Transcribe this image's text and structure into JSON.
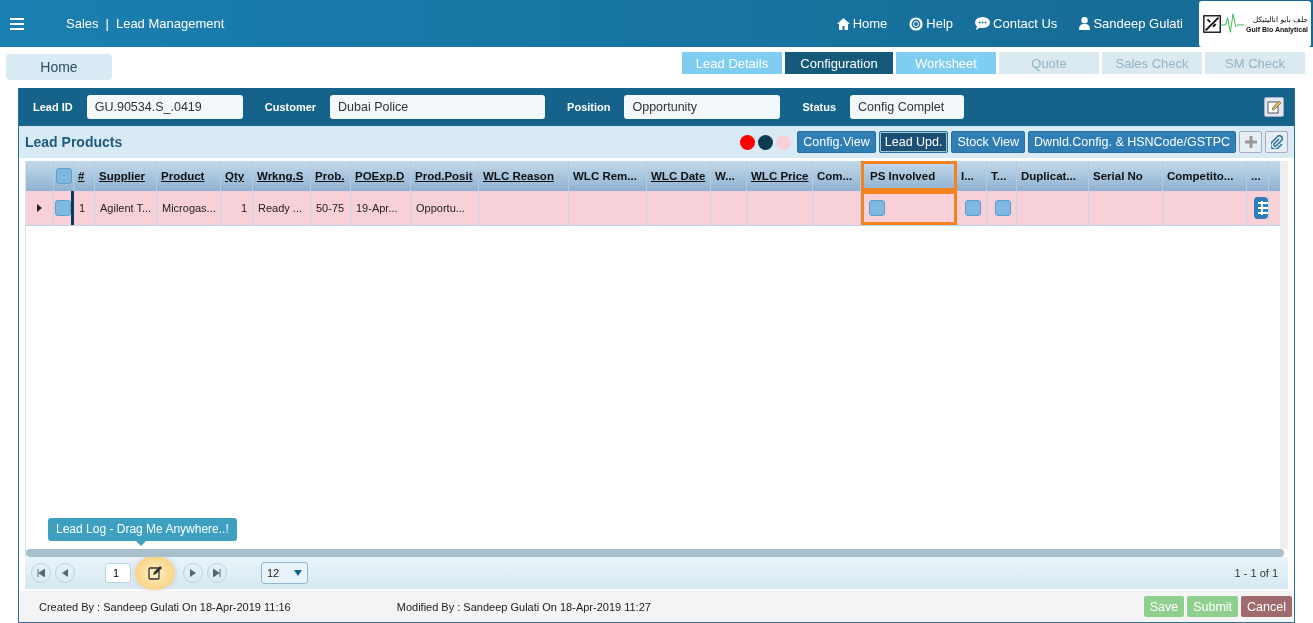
{
  "header": {
    "module": "Sales",
    "separator": "|",
    "title": "Lead Management",
    "nav": [
      {
        "kind": "home",
        "label": "Home"
      },
      {
        "kind": "help",
        "label": "Help"
      },
      {
        "kind": "contact",
        "label": "Contact Us"
      },
      {
        "kind": "user",
        "label": "Sandeep Gulati"
      }
    ],
    "logo": {
      "arabic": "جلف بايو اناليتيكل",
      "english": "Gulf Bio Analytical"
    }
  },
  "home_button": "Home",
  "tabs": [
    {
      "label": "Lead Details",
      "selected": false,
      "disabled": false
    },
    {
      "label": "Configuration",
      "selected": true,
      "disabled": false
    },
    {
      "label": "Worksheet",
      "selected": false,
      "disabled": false
    },
    {
      "label": "Quote",
      "selected": false,
      "disabled": true
    },
    {
      "label": "Sales Check",
      "selected": false,
      "disabled": true
    },
    {
      "label": "SM Check",
      "selected": false,
      "disabled": true
    }
  ],
  "form": [
    {
      "label": "Lead ID",
      "value": "GU.90534.S_.0419"
    },
    {
      "label": "Customer",
      "value": "Dubai Police"
    },
    {
      "label": "Position",
      "value": "Opportunity"
    },
    {
      "label": "Status",
      "value": "Config Complet"
    }
  ],
  "panel_title": "Lead Products",
  "legend": [
    {
      "color": "#ff0000"
    },
    {
      "color": "#0d3b52"
    },
    {
      "color": "#f7d0d8"
    }
  ],
  "toolbar": [
    {
      "label": "Config.View",
      "selected": false
    },
    {
      "label": "Lead Upd.",
      "selected": true
    },
    {
      "label": "Stock View",
      "selected": false
    },
    {
      "label": "Dwnld.Config. & HSNCode/GSTPC",
      "selected": false
    }
  ],
  "columns": [
    {
      "kind": "expand"
    },
    {
      "kind": "check",
      "checked": false
    },
    {
      "label": "#",
      "sortable": true,
      "highlighted": false
    },
    {
      "label": "Supplier",
      "sortable": true,
      "highlighted": false
    },
    {
      "label": "Product",
      "sortable": true,
      "highlighted": false
    },
    {
      "label": "Qty",
      "sortable": true,
      "highlighted": false
    },
    {
      "label": "Wrkng.S",
      "sortable": true,
      "highlighted": false
    },
    {
      "label": "Prob.",
      "sortable": true,
      "highlighted": false
    },
    {
      "label": "POExp.D",
      "sortable": true,
      "highlighted": false
    },
    {
      "label": "Prod.Posit",
      "sortable": true,
      "highlighted": false
    },
    {
      "label": "WLC Reason",
      "sortable": true,
      "highlighted": false
    },
    {
      "label": "WLC Rem...",
      "sortable": false,
      "highlighted": false
    },
    {
      "label": "WLC Date",
      "sortable": true,
      "highlighted": false
    },
    {
      "label": "W...",
      "sortable": false,
      "highlighted": false
    },
    {
      "label": "WLC Price",
      "sortable": true,
      "highlighted": false
    },
    {
      "label": "Com...",
      "sortable": false,
      "highlighted": false
    },
    {
      "label": "PS Involved",
      "sortable": false,
      "highlighted": true
    },
    {
      "label": "I...",
      "sortable": false,
      "highlighted": false
    },
    {
      "label": "T...",
      "sortable": false,
      "highlighted": false
    },
    {
      "label": "Duplicat...",
      "sortable": false,
      "highlighted": false
    },
    {
      "label": "Serial No",
      "sortable": false,
      "highlighted": false
    },
    {
      "label": "Competito...",
      "sortable": false,
      "highlighted": false
    },
    {
      "label": "...",
      "sortable": false,
      "highlighted": false
    }
  ],
  "rows": [
    {
      "selected": true,
      "cells": [
        {
          "kind": "expand"
        },
        {
          "kind": "check",
          "checked": false
        },
        {
          "kind": "text",
          "text": "1"
        },
        {
          "kind": "text",
          "text": "Agilent T..."
        },
        {
          "kind": "text",
          "text": "Microgas..."
        },
        {
          "kind": "num",
          "text": "1"
        },
        {
          "kind": "text",
          "text": "Ready ..."
        },
        {
          "kind": "text",
          "text": "50-75"
        },
        {
          "kind": "text",
          "text": "19-Apr..."
        },
        {
          "kind": "text",
          "text": "Opportu..."
        },
        {
          "kind": "empty"
        },
        {
          "kind": "empty"
        },
        {
          "kind": "empty"
        },
        {
          "kind": "empty"
        },
        {
          "kind": "empty"
        },
        {
          "kind": "empty"
        },
        {
          "kind": "check",
          "checked": false
        },
        {
          "kind": "check",
          "checked": false
        },
        {
          "kind": "check",
          "checked": false
        },
        {
          "kind": "empty"
        },
        {
          "kind": "empty"
        },
        {
          "kind": "empty"
        },
        {
          "kind": "menu"
        }
      ]
    }
  ],
  "tooltip": "Lead Log - Drag Me Anywhere..!",
  "pager": {
    "page": "1",
    "page_size": "12",
    "summary": "1 - 1 of 1"
  },
  "footer": {
    "created": "Created By : Sandeep Gulati On 18-Apr-2019 11:16",
    "modified": "Modified By : Sandeep Gulati On 18-Apr-2019 11:27",
    "buttons": [
      {
        "kind": "save",
        "label": "Save",
        "disabled": true
      },
      {
        "kind": "save",
        "label": "Submit",
        "disabled": true
      },
      {
        "kind": "cancel",
        "label": "Cancel",
        "disabled": false
      }
    ]
  }
}
